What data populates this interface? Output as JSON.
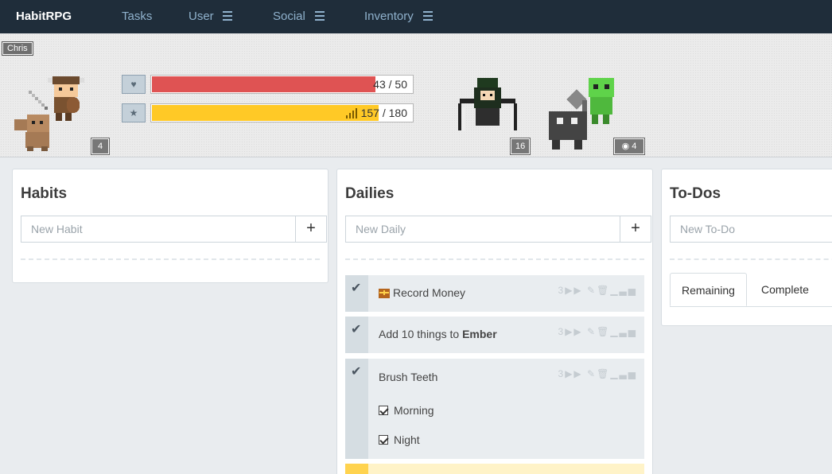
{
  "nav": {
    "brand": "HabitRPG",
    "items": [
      {
        "label": "Tasks",
        "menu": false
      },
      {
        "label": "User",
        "menu": true
      },
      {
        "label": "Social",
        "menu": true
      },
      {
        "label": "Inventory",
        "menu": true
      }
    ]
  },
  "header": {
    "user_name": "Chris",
    "level": "4",
    "health": {
      "text": "43 / 50",
      "fraction": 0.86,
      "color": "#df5353"
    },
    "experience": {
      "text": "157 / 180",
      "fraction": 0.872,
      "color": "#ffc926"
    },
    "party_member_level": "16",
    "mount_badge": "4"
  },
  "habits": {
    "title": "Habits",
    "placeholder": "New Habit",
    "add": "+"
  },
  "dailies": {
    "title": "Dailies",
    "placeholder": "New Daily",
    "add": "+",
    "tasks": [
      {
        "label": "Record Money",
        "streak": "3"
      },
      {
        "label_prefix": "Add 10 things to ",
        "label_bold": "Ember",
        "streak": "3"
      },
      {
        "label": "Brush Teeth",
        "streak": "3",
        "checklist": [
          "Morning",
          "Night"
        ]
      }
    ]
  },
  "todos": {
    "title": "To-Dos",
    "placeholder": "New To-Do",
    "tabs": [
      "Remaining",
      "Complete"
    ]
  },
  "colors": {
    "nav_bg": "#1f2d3a",
    "health": "#df5353",
    "experience": "#ffc926"
  }
}
